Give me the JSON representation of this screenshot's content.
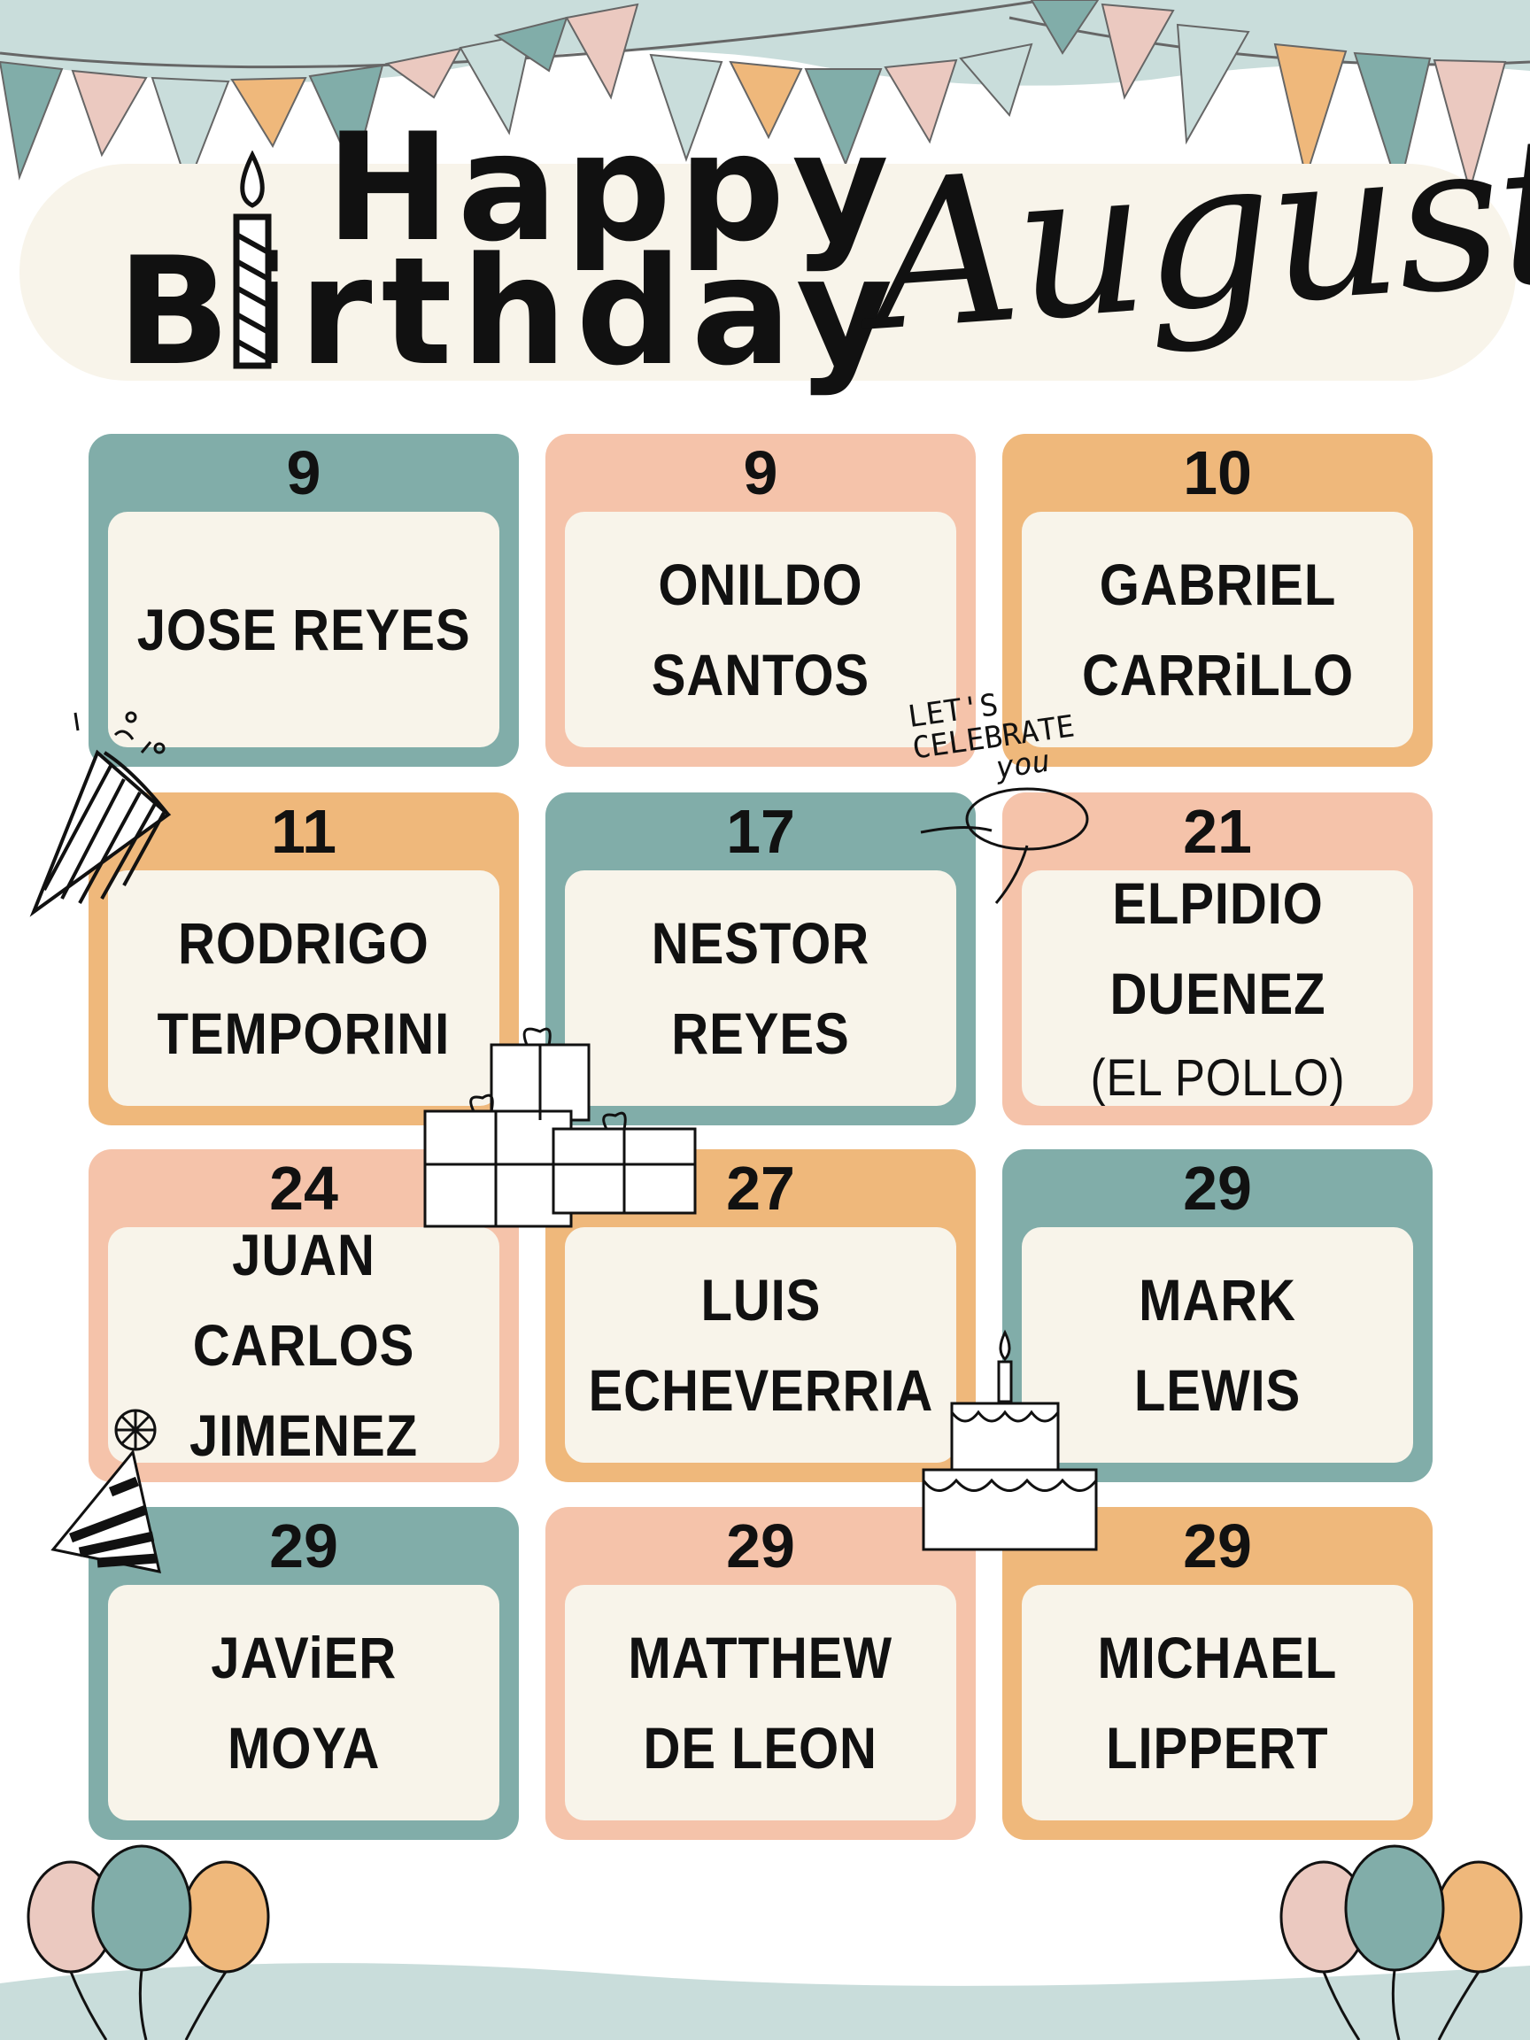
{
  "header": {
    "line1": "Happy",
    "line2": "Birthday",
    "month": "August"
  },
  "colors": {
    "teal": "#81ada9",
    "peach": "#f5c3aa",
    "orange": "#efb87b",
    "cream": "#f8f4ea",
    "background": "#ffffff",
    "ink": "#111111"
  },
  "birthdays": [
    {
      "day": "9",
      "lines": [
        "JOSE REYES"
      ],
      "color": "teal"
    },
    {
      "day": "9",
      "lines": [
        "ONILDO",
        "SANTOS"
      ],
      "color": "peach"
    },
    {
      "day": "10",
      "lines": [
        "GABRIEL",
        "CARRiLLO"
      ],
      "color": "orange"
    },
    {
      "day": "11",
      "lines": [
        "RODRIGO",
        "TEMPORINI"
      ],
      "color": "orange"
    },
    {
      "day": "17",
      "lines": [
        "NESTOR",
        "REYES"
      ],
      "color": "teal"
    },
    {
      "day": "21",
      "lines": [
        "ELPIDIO",
        "DUENEZ",
        "(EL POLLO)"
      ],
      "color": "peach"
    },
    {
      "day": "24",
      "lines": [
        "JUAN CARLOS",
        "JIMENEZ"
      ],
      "color": "peach"
    },
    {
      "day": "27",
      "lines": [
        "LUIS",
        "ECHEVERRIA"
      ],
      "color": "orange"
    },
    {
      "day": "29",
      "lines": [
        "MARK",
        "LEWIS"
      ],
      "color": "teal"
    },
    {
      "day": "29",
      "lines": [
        "JAViER",
        "MOYA"
      ],
      "color": "teal"
    },
    {
      "day": "29",
      "lines": [
        "MATTHEW",
        "DE LEON"
      ],
      "color": "peach"
    },
    {
      "day": "29",
      "lines": [
        "MICHAEL",
        "LIPPERT"
      ],
      "color": "orange"
    }
  ],
  "decorations": {
    "stamp_text": [
      "LET'S",
      "CELEBRATE",
      "you"
    ],
    "icons": [
      "bunting-icon",
      "candle-icon",
      "party-horn-icon",
      "gifts-icon",
      "cake-icon",
      "party-hat-icon",
      "balloons-icon"
    ]
  }
}
